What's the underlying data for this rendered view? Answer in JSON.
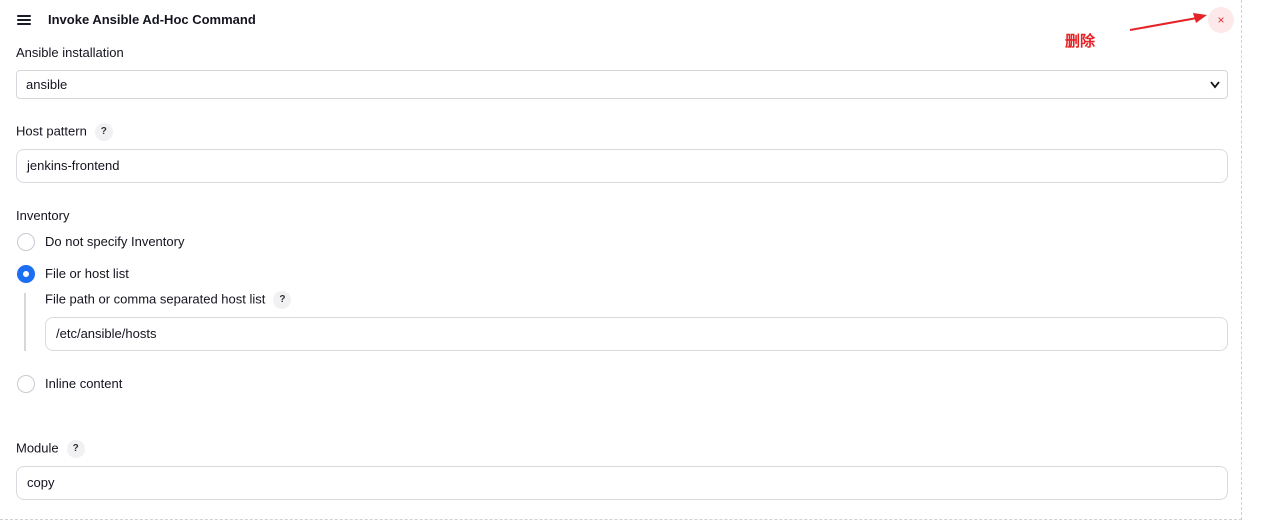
{
  "header": {
    "title": "Invoke Ansible Ad-Hoc Command",
    "delete_symbol": "×"
  },
  "annotation": {
    "label": "删除",
    "color": "#e52326"
  },
  "ansible_installation": {
    "label": "Ansible installation",
    "selected": "ansible"
  },
  "host_pattern": {
    "label": "Host pattern",
    "help": "?",
    "value": "jenkins-frontend"
  },
  "inventory": {
    "label": "Inventory",
    "options": [
      {
        "label": "Do not specify Inventory",
        "checked": false
      },
      {
        "label": "File or host list",
        "checked": true
      },
      {
        "label": "Inline content",
        "checked": false
      }
    ],
    "file_path": {
      "label": "File path or comma separated host list",
      "help": "?",
      "value": "/etc/ansible/hosts"
    }
  },
  "module": {
    "label": "Module",
    "help": "?",
    "value": "copy"
  },
  "colors": {
    "accent": "#1c6ef2",
    "delete_bg": "#fde8ea",
    "delete_fg": "#e0303a"
  }
}
